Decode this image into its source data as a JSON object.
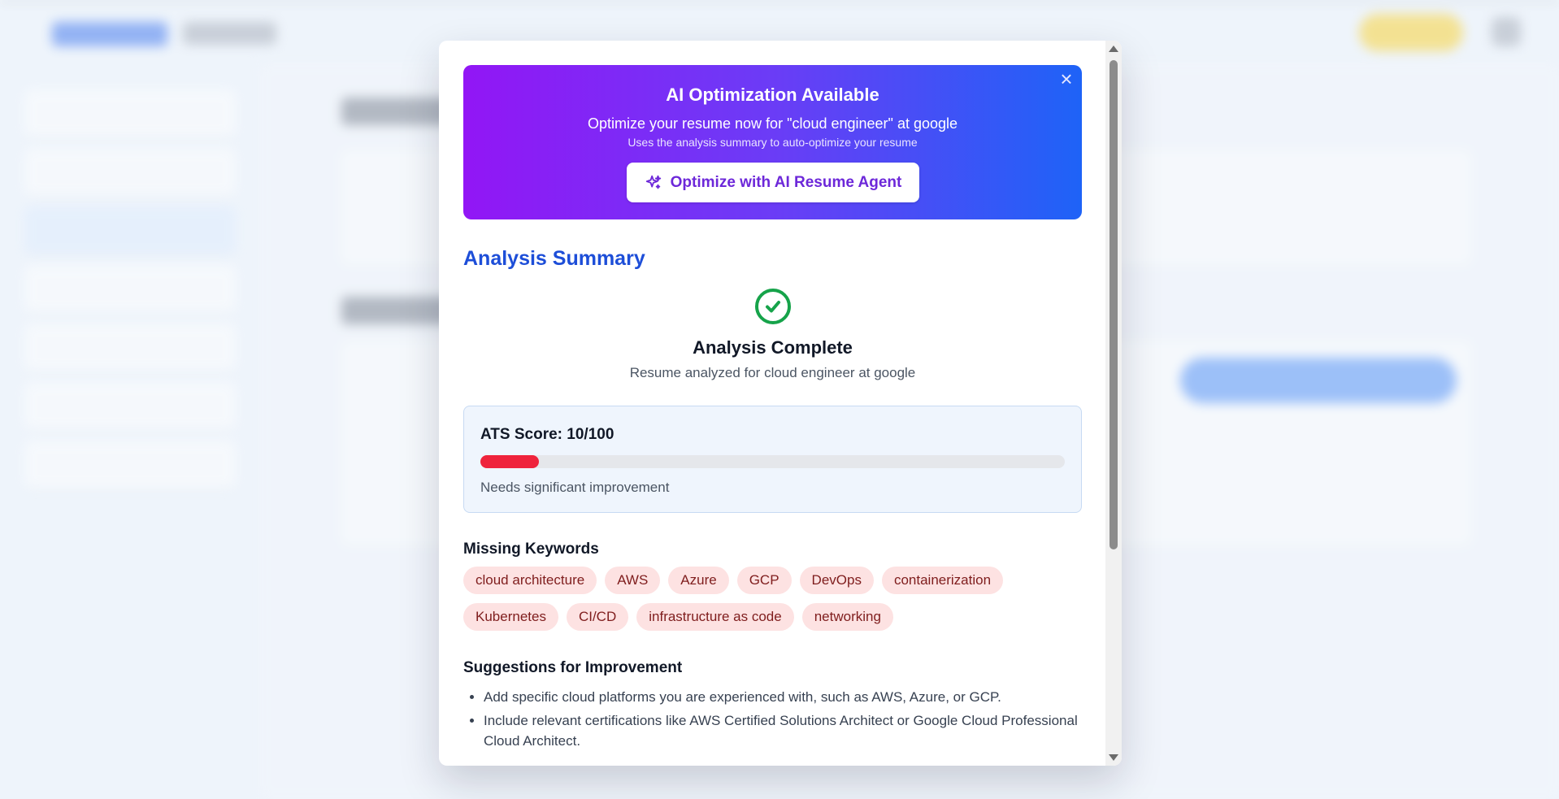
{
  "colors": {
    "accent": "#1d4ed8",
    "banner_start": "#9216f5",
    "banner_end": "#1e63f7",
    "score_bar": "#ef233c",
    "success": "#16a34a",
    "tag_bg": "#fde2e2"
  },
  "banner": {
    "title": "AI Optimization Available",
    "subtitle": "Optimize your resume now for \"cloud engineer\" at google",
    "note": "Uses the analysis summary to auto-optimize your resume",
    "button_label": "Optimize with AI Resume Agent",
    "close_icon": "×"
  },
  "summary": {
    "title": "Analysis Summary",
    "status_title": "Analysis Complete",
    "status_subtitle": "Resume analyzed for cloud engineer at google"
  },
  "ats": {
    "label": "ATS Score: 10/100",
    "score": 10,
    "max": 100,
    "note": "Needs significant improvement"
  },
  "keywords": {
    "title": "Missing Keywords",
    "items": [
      "cloud architecture",
      "AWS",
      "Azure",
      "GCP",
      "DevOps",
      "containerization",
      "Kubernetes",
      "CI/CD",
      "infrastructure as code",
      "networking"
    ]
  },
  "suggestions": {
    "title": "Suggestions for Improvement",
    "items": [
      "Add specific cloud platforms you are experienced with, such as AWS, Azure, or GCP.",
      "Include relevant certifications like AWS Certified Solutions Architect or Google Cloud Professional Cloud Architect."
    ]
  }
}
